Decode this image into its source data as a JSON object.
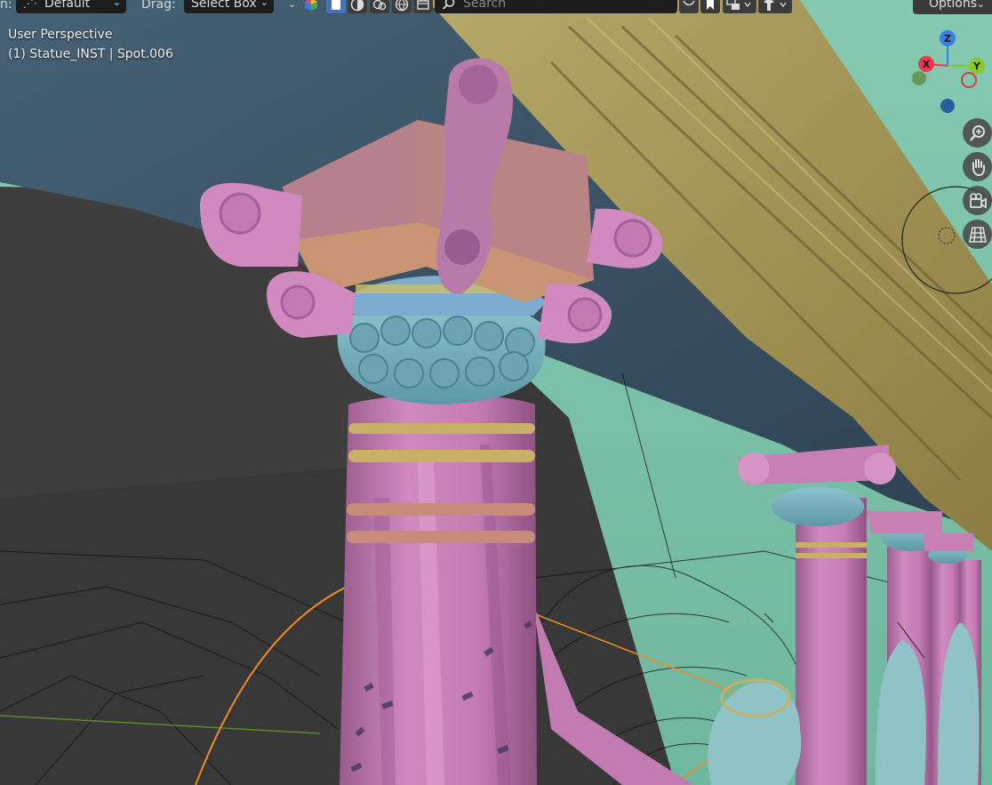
{
  "header": {
    "mode_label": "n:",
    "orientation_value": "Default",
    "drag_label": "Drag:",
    "drag_value": "Select Box",
    "search_placeholder": "Search",
    "options_label": "Options",
    "icons": [
      "transform-orientation-icon",
      "chevron-down-icon",
      "render-color-icon",
      "shading-solid-icon",
      "shading-material-icon",
      "shading-xray-icon",
      "shading-rendered-icon",
      "filter-icon",
      "search-icon",
      "bookmark-icon",
      "pivot-icon",
      "snap-icon"
    ]
  },
  "viewport": {
    "view_name": "User Perspective",
    "object_info": "(1) Statue_INST | Spot.006"
  },
  "gizmo": {
    "axis_x": "X",
    "axis_y": "Y",
    "axis_z": "Z",
    "colors": {
      "x": "#f0384c",
      "y": "#8ac826",
      "z": "#3b82e0"
    }
  },
  "nav_buttons": [
    "zoom-icon",
    "hand-icon",
    "camera-icon",
    "grid-icon"
  ],
  "colors": {
    "accent": "#4772b3",
    "statue_pink": "#c87fb4",
    "capital_blue": "#7fb2c0",
    "beam_gold": "#a89a5c",
    "ceiling_slate": "#3f5566",
    "sky_teal": "#7fc2ab",
    "floor_gray": "#3a3a3a"
  }
}
